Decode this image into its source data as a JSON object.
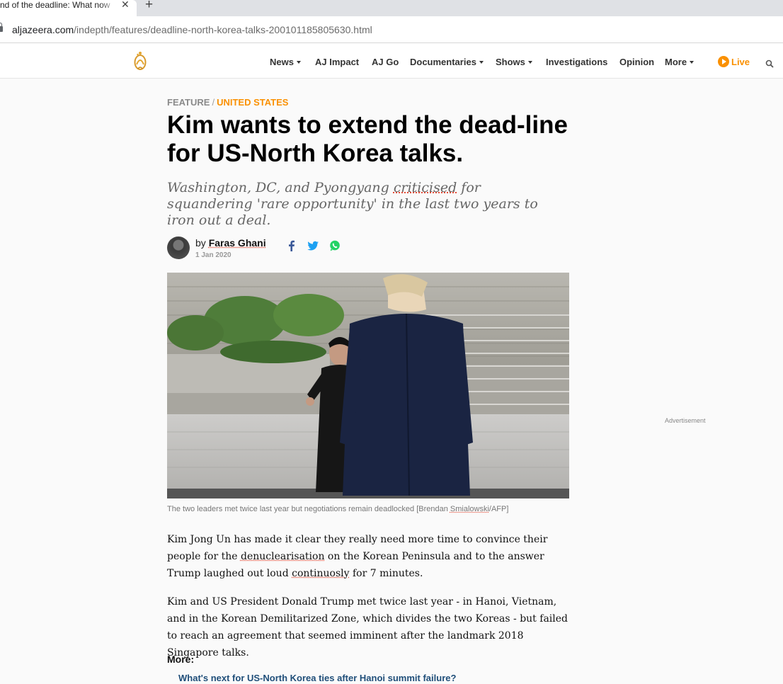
{
  "browser": {
    "tab_title": "nd of the deadline: What now",
    "tab_close": "✕",
    "new_tab": "+",
    "url_host": "aljazeera.com",
    "url_path": "/indepth/features/deadline-north-korea-talks-200101185805630.html"
  },
  "nav": {
    "items": [
      "News",
      "AJ Impact",
      "AJ Go",
      "Documentaries",
      "Shows",
      "Investigations",
      "Opinion",
      "More"
    ],
    "live_label": "Live"
  },
  "article": {
    "kicker_section": "FEATURE",
    "kicker_separator": "/",
    "kicker_topic": "UNITED STATES",
    "headline": "Kim wants to extend the dead-line for US-North Korea talks.",
    "standfirst_before": "Washington, DC, and Pyongyang ",
    "standfirst_flagged": "criticised",
    "standfirst_after": " for squandering 'rare opportunity' in the last two years to iron out a deal.",
    "by_prefix": "by ",
    "author": "Faras Ghani",
    "date": "1 Jan 2020",
    "caption_before": "The two leaders met twice last year but negotiations remain deadlocked [Brendan ",
    "caption_flagged": "Smialowski",
    "caption_after": "/AFP]",
    "p1_a": "Kim Jong Un has made it clear they really need more time to convince their people for the ",
    "p1_flag1": "denuclearisation",
    "p1_b": " on the Korean Peninsula and to the answer Trump laughed out loud ",
    "p1_flag2": "continuosly",
    "p1_c": " for 7 minutes.",
    "p2": "Kim and US President Donald Trump met twice last year - in Hanoi, Vietnam, and in the Korean Demilitarized Zone, which divides the two Koreas - but failed to reach an agreement that seemed imminent after the landmark 2018 Singapore talks.",
    "more_label": "More:",
    "more_link": "What's next for US-North Korea ties after Hanoi summit failure?"
  },
  "sidebar": {
    "ad_label": "Advertisement"
  },
  "colors": {
    "accent": "#fa9000",
    "facebook": "#3b5998",
    "twitter": "#1da1f2",
    "whatsapp": "#25d366"
  }
}
